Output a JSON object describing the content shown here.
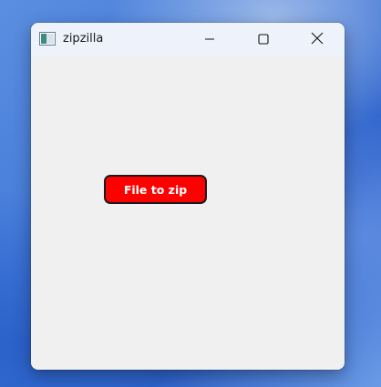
{
  "window": {
    "title": "zipzilla",
    "icon": "app-window-icon",
    "controls": {
      "minimize_icon": "minimize-icon",
      "maximize_icon": "maximize-icon",
      "close_icon": "close-icon"
    }
  },
  "main": {
    "file_button_label": "File to zip",
    "file_button_color": "#ff0000"
  }
}
